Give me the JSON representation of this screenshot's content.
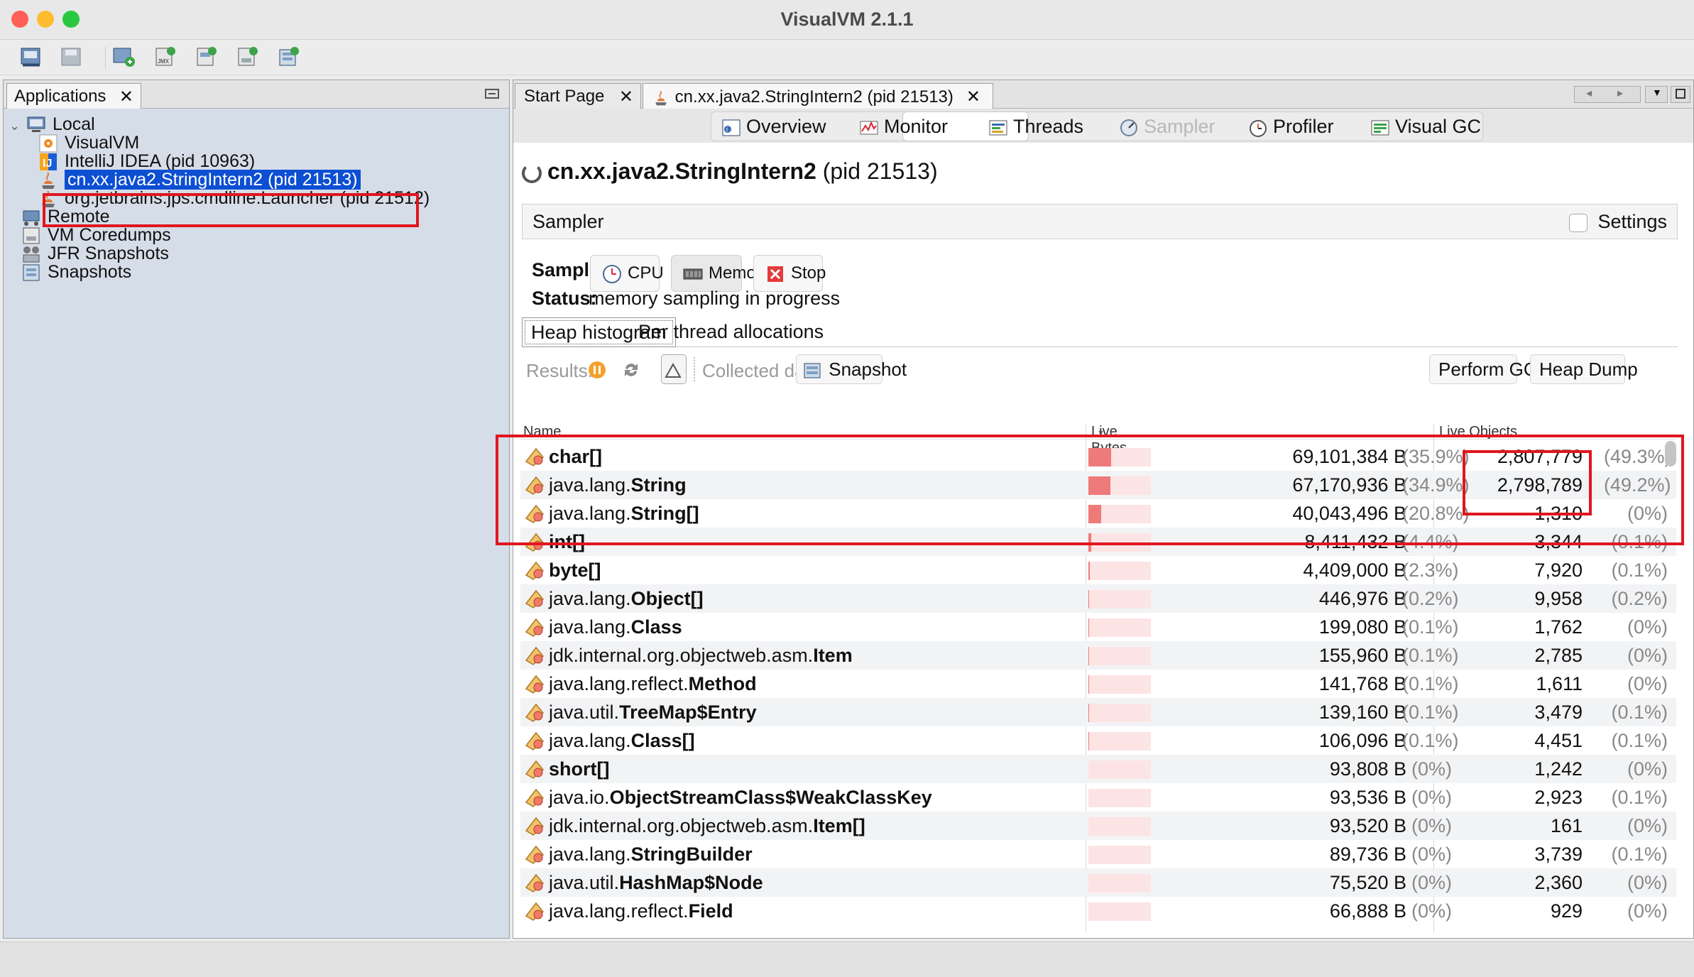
{
  "window": {
    "title": "VisualVM 2.1.1",
    "traffic_colors": {
      "close": "#ff5f57",
      "minimize": "#febc2e",
      "maximize": "#28c840"
    }
  },
  "toolbar": {
    "buttons": [
      "load-application-snapshot-icon",
      "save-icon",
      "add-jmx-connection-icon",
      "add-jmx-file-icon",
      "add-remote-host-icon",
      "add-coredump-icon",
      "add-snapshot-icon"
    ]
  },
  "left_panel": {
    "tab_label": "Applications",
    "tab_close": "✕",
    "tree": {
      "local": "Local",
      "visualvm": "VisualVM",
      "intellij": "IntelliJ IDEA (pid 10963)",
      "selected_app": "cn.xx.java2.StringIntern2 (pid 21513)",
      "launcher": "org.jetbrains.jps.cmdline.Launcher (pid 21512)",
      "remote": "Remote",
      "coredumps": "VM Coredumps",
      "jfr": "JFR Snapshots",
      "snapshots": "Snapshots"
    }
  },
  "right_panel": {
    "tabs": {
      "start_page": "Start Page",
      "app_tab": "cn.xx.java2.StringIntern2 (pid 21513)",
      "close": "✕"
    },
    "view_tabs": {
      "overview": "Overview",
      "monitor": "Monitor",
      "threads": "Threads",
      "sampler": "Sampler",
      "profiler": "Profiler",
      "visual_gc": "Visual GC"
    },
    "process_name": "cn.xx.java2.StringIntern2",
    "process_pid": "(pid 21513)",
    "sampler_header": "Sampler",
    "settings_label": "Settings",
    "sample_label": "Sample:",
    "buttons": {
      "cpu": "CPU",
      "memory": "Memory",
      "stop": "Stop"
    },
    "status_label": "Status:",
    "status_text": "memory sampling in progress",
    "sub_tabs": {
      "heap": "Heap histogram",
      "per_thread": "Per thread allocations"
    },
    "results_label": "Results:",
    "collected_label": "Collected data:",
    "snapshot_button": "Snapshot",
    "perform_gc": "Perform GC",
    "heap_dump": "Heap Dump"
  },
  "table": {
    "headers": {
      "name": "Name",
      "live_bytes": "Live Bytes",
      "sort_indicator": "▾",
      "live_objects": "Live Objects"
    },
    "rows": [
      {
        "prefix": "",
        "bold": "char[]",
        "bytes": "69,101,384 B",
        "bpct": "(35.9%)",
        "objs": "2,807,779",
        "opct": "(49.3%)",
        "share": 0.359
      },
      {
        "prefix": "java.lang.",
        "bold": "String",
        "bytes": "67,170,936 B",
        "bpct": "(34.9%)",
        "objs": "2,798,789",
        "opct": "(49.2%)",
        "share": 0.349
      },
      {
        "prefix": "java.lang.",
        "bold": "String[]",
        "bytes": "40,043,496 B",
        "bpct": "(20.8%)",
        "objs": "1,310",
        "opct": "(0%)",
        "share": 0.208
      },
      {
        "prefix": "",
        "bold": "int[]",
        "bytes": "8,411,432 B",
        "bpct": "(4.4%)",
        "objs": "3,344",
        "opct": "(0.1%)",
        "share": 0.044
      },
      {
        "prefix": "",
        "bold": "byte[]",
        "bytes": "4,409,000 B",
        "bpct": "(2.3%)",
        "objs": "7,920",
        "opct": "(0.1%)",
        "share": 0.023
      },
      {
        "prefix": "java.lang.",
        "bold": "Object[]",
        "bytes": "446,976 B",
        "bpct": "(0.2%)",
        "objs": "9,958",
        "opct": "(0.2%)",
        "share": 0.002
      },
      {
        "prefix": "java.lang.",
        "bold": "Class",
        "bytes": "199,080 B",
        "bpct": "(0.1%)",
        "objs": "1,762",
        "opct": "(0%)",
        "share": 0.001
      },
      {
        "prefix": "jdk.internal.org.objectweb.asm.",
        "bold": "Item",
        "bytes": "155,960 B",
        "bpct": "(0.1%)",
        "objs": "2,785",
        "opct": "(0%)",
        "share": 0.001
      },
      {
        "prefix": "java.lang.reflect.",
        "bold": "Method",
        "bytes": "141,768 B",
        "bpct": "(0.1%)",
        "objs": "1,611",
        "opct": "(0%)",
        "share": 0.001
      },
      {
        "prefix": "java.util.",
        "bold": "TreeMap$Entry",
        "bytes": "139,160 B",
        "bpct": "(0.1%)",
        "objs": "3,479",
        "opct": "(0.1%)",
        "share": 0.001
      },
      {
        "prefix": "java.lang.",
        "bold": "Class[]",
        "bytes": "106,096 B",
        "bpct": "(0.1%)",
        "objs": "4,451",
        "opct": "(0.1%)",
        "share": 0.001
      },
      {
        "prefix": "",
        "bold": "short[]",
        "bytes": "93,808 B",
        "bpct": "(0%)",
        "objs": "1,242",
        "opct": "(0%)",
        "share": 0
      },
      {
        "prefix": "java.io.",
        "bold": "ObjectStreamClass$WeakClassKey",
        "bytes": "93,536 B",
        "bpct": "(0%)",
        "objs": "2,923",
        "opct": "(0.1%)",
        "share": 0
      },
      {
        "prefix": "jdk.internal.org.objectweb.asm.",
        "bold": "Item[]",
        "bytes": "93,520 B",
        "bpct": "(0%)",
        "objs": "161",
        "opct": "(0%)",
        "share": 0
      },
      {
        "prefix": "java.lang.",
        "bold": "StringBuilder",
        "bytes": "89,736 B",
        "bpct": "(0%)",
        "objs": "3,739",
        "opct": "(0.1%)",
        "share": 0
      },
      {
        "prefix": "java.util.",
        "bold": "HashMap$Node",
        "bytes": "75,520 B",
        "bpct": "(0%)",
        "objs": "2,360",
        "opct": "(0%)",
        "share": 0
      },
      {
        "prefix": "java.lang.reflect.",
        "bold": "Field",
        "bytes": "66,888 B",
        "bpct": "(0%)",
        "objs": "929",
        "opct": "(0%)",
        "share": 0
      }
    ]
  },
  "colors": {
    "selection": "#0d4fd3",
    "annotation_red": "#e0161f",
    "bar_fill": "#ee7a7a",
    "bar_bg": "#fde4e4"
  }
}
